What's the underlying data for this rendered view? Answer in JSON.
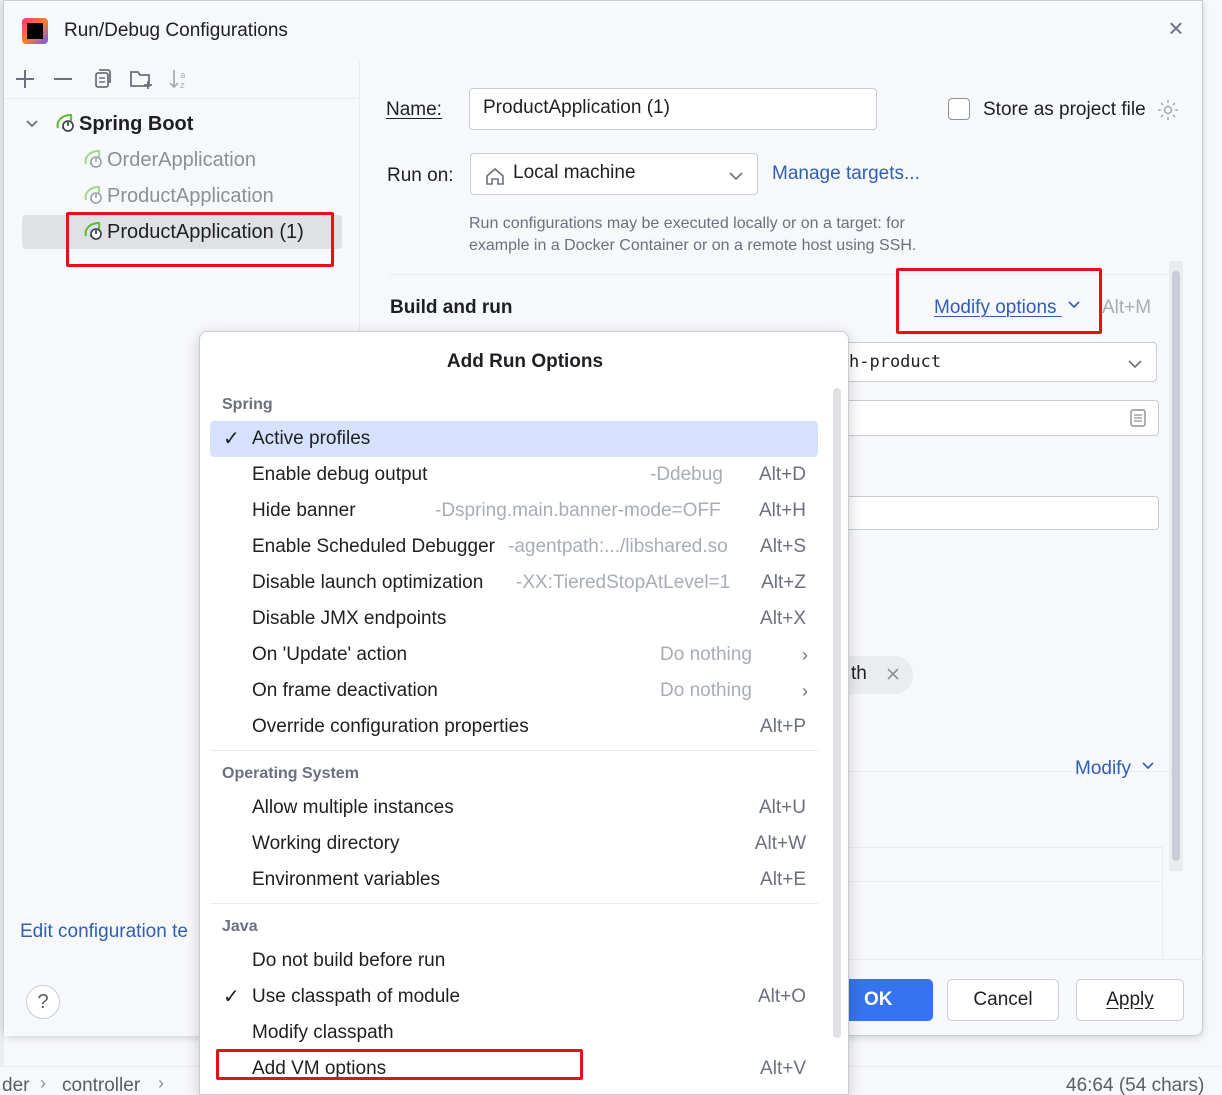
{
  "window": {
    "title": "Run/Debug Configurations",
    "close_icon": "close-icon"
  },
  "left": {
    "toolbar": [
      "add-icon",
      "remove-icon",
      "copy-icon",
      "new-folder-icon",
      "sort-icon"
    ],
    "tree": {
      "group_label": "Spring Boot",
      "items": [
        {
          "label": "OrderApplication",
          "selected": false
        },
        {
          "label": "ProductApplication",
          "selected": false
        },
        {
          "label": "ProductApplication (1)",
          "selected": true
        }
      ]
    },
    "edit_templates_label": "Edit configuration te",
    "help_label": "?"
  },
  "form": {
    "name_label": "Name:",
    "name_value": "ProductApplication (1)",
    "store_label": "Store as project file",
    "store_checked": false,
    "run_on_label": "Run on:",
    "run_on_value": "Local machine",
    "manage_targets": "Manage targets...",
    "hint_line1": "Run configurations may be executed locally or on a target: for",
    "hint_line2": "example in a Docker Container or on a remote host using SSH.",
    "build_run_title": "Build and run",
    "modify_options": "Modify options",
    "modify_shortcut": "Alt+M",
    "module_value_partial": "h-product",
    "chip_partial": "th",
    "modify_link": "Modify",
    "ok": "OK",
    "cancel": "Cancel",
    "apply": "Apply"
  },
  "popup": {
    "title": "Add Run Options",
    "groups": [
      {
        "header": "Spring",
        "items": [
          {
            "label": "Active profiles",
            "param": "",
            "key": "",
            "checked": true,
            "selected": true,
            "submenu": false
          },
          {
            "label": "Enable debug output",
            "param": "-Ddebug",
            "key": "Alt+D",
            "checked": false,
            "selected": false,
            "submenu": false
          },
          {
            "label": "Hide banner",
            "param": "-Dspring.main.banner-mode=OFF",
            "key": "Alt+H",
            "checked": false,
            "selected": false,
            "submenu": false
          },
          {
            "label": "Enable Scheduled Debugger",
            "param": "-agentpath:.../libshared.so",
            "key": "Alt+S",
            "checked": false,
            "selected": false,
            "submenu": false
          },
          {
            "label": "Disable launch optimization",
            "param": "-XX:TieredStopAtLevel=1",
            "key": "Alt+Z",
            "checked": false,
            "selected": false,
            "submenu": false
          },
          {
            "label": "Disable JMX endpoints",
            "param": "",
            "key": "Alt+X",
            "checked": false,
            "selected": false,
            "submenu": false
          },
          {
            "label": "On 'Update' action",
            "param": "Do nothing",
            "key": "",
            "checked": false,
            "selected": false,
            "submenu": true
          },
          {
            "label": "On frame deactivation",
            "param": "Do nothing",
            "key": "",
            "checked": false,
            "selected": false,
            "submenu": true
          },
          {
            "label": "Override configuration properties",
            "param": "",
            "key": "Alt+P",
            "checked": false,
            "selected": false,
            "submenu": false
          }
        ]
      },
      {
        "header": "Operating System",
        "items": [
          {
            "label": "Allow multiple instances",
            "param": "",
            "key": "Alt+U",
            "checked": false,
            "selected": false,
            "submenu": false
          },
          {
            "label": "Working directory",
            "param": "",
            "key": "Alt+W",
            "checked": false,
            "selected": false,
            "submenu": false
          },
          {
            "label": "Environment variables",
            "param": "",
            "key": "Alt+E",
            "checked": false,
            "selected": false,
            "submenu": false
          }
        ]
      },
      {
        "header": "Java",
        "items": [
          {
            "label": "Do not build before run",
            "param": "",
            "key": "",
            "checked": false,
            "selected": false,
            "submenu": false
          },
          {
            "label": "Use classpath of module",
            "param": "",
            "key": "Alt+O",
            "checked": true,
            "selected": false,
            "submenu": false
          },
          {
            "label": "Modify classpath",
            "param": "",
            "key": "",
            "checked": false,
            "selected": false,
            "submenu": false
          },
          {
            "label": "Add VM options",
            "param": "",
            "key": "Alt+V",
            "checked": false,
            "selected": false,
            "submenu": false
          }
        ]
      }
    ]
  },
  "statusbar": {
    "crumb1": "der",
    "crumb2": "controller",
    "position": "46:64 (54 chars)"
  },
  "colors": {
    "accent": "#3574f0",
    "link": "#2f5eb3",
    "annotation": "#e4111b",
    "selection": "#d5e1fd",
    "spring_green": "#5fb832"
  }
}
